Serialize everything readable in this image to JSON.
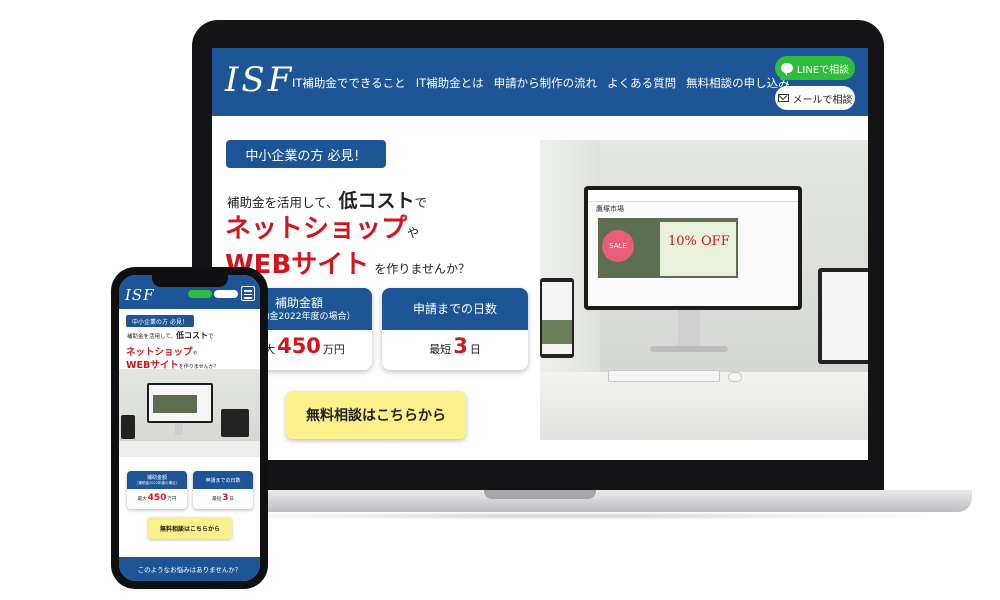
{
  "site": {
    "logo": "ISF",
    "nav": [
      "IT補助金でできること",
      "IT補助金とは",
      "申請から制作の流れ",
      "よくある質問",
      "無料相談の申し込み"
    ],
    "line_button": "LINEで相談",
    "mail_button": "メールで相談"
  },
  "hero": {
    "badge": "中小企業の方 必見！",
    "line1_pre": "補助金を活用して、",
    "line1_bold": "低コスト",
    "line1_post": "で",
    "highlight1": "ネットショップ",
    "highlight1_suffix": "や",
    "highlight2": "WEBサイト",
    "highlight2_suffix": "を作りませんか？"
  },
  "cards": [
    {
      "title": "補助金額",
      "subtitle": "（補助金2022年度の場合）",
      "prefix": "最大",
      "value": "450",
      "unit": "万円"
    },
    {
      "title": "申請までの日数",
      "subtitle": "",
      "prefix": "最短",
      "value": "3",
      "unit": "日"
    }
  ],
  "cta": "無料相談はこちらから",
  "photo": {
    "shop_name": "鷹塚市場",
    "sale_badge": "SALE",
    "discount": "10% OFF"
  },
  "phone": {
    "footer_text": "このようなお悩みはありませんか？"
  },
  "colors": {
    "brand_blue": "#1d5596",
    "accent_red": "#d2161d",
    "line_green": "#2fbd3c",
    "cta_yellow": "#fbf08c"
  }
}
